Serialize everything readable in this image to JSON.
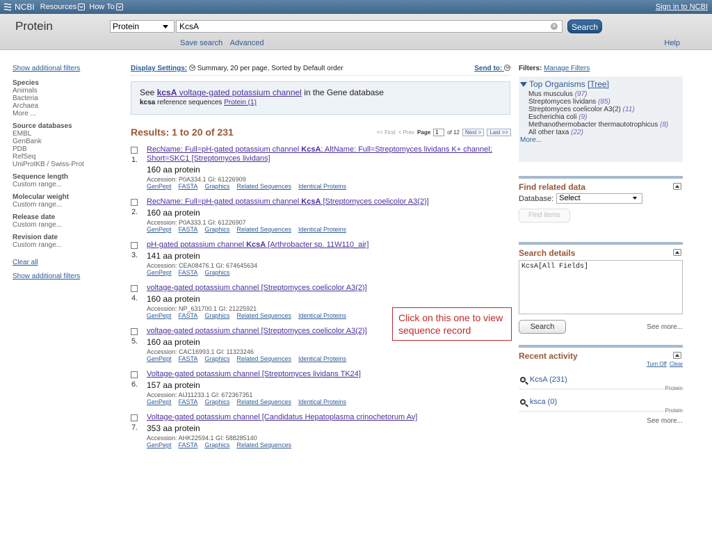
{
  "topbar": {
    "logo": "NCBI",
    "menus": [
      "Resources",
      "How To"
    ],
    "signin": "Sign in to NCBI"
  },
  "search": {
    "db_title": "Protein",
    "db_select": "Protein",
    "term": "KcsA",
    "button": "Search",
    "save_search": "Save search",
    "advanced": "Advanced",
    "help": "Help"
  },
  "left": {
    "show_filters_top": "Show additional filters",
    "sections": [
      {
        "title": "Species",
        "items": [
          "Animals",
          "Bacteria",
          "Archaea",
          "More ..."
        ]
      },
      {
        "title": "Source databases",
        "items": [
          "EMBL",
          "GenBank",
          "PDB",
          "RefSeq",
          "UniProtKB / Swiss-Prot"
        ]
      },
      {
        "title": "Sequence length",
        "items": [
          "Custom range..."
        ]
      },
      {
        "title": "Molecular weight",
        "items": [
          "Custom range..."
        ]
      },
      {
        "title": "Release date",
        "items": [
          "Custom range..."
        ]
      },
      {
        "title": "Revision date",
        "items": [
          "Custom range..."
        ]
      }
    ],
    "clear_all": "Clear all",
    "show_filters_bottom": "Show additional filters"
  },
  "display": {
    "settings_label": "Display Settings:",
    "settings_value": "Summary, 20 per page, Sorted by Default order",
    "send_to": "Send to:"
  },
  "gene_box": {
    "see": "See",
    "gene_link_bold": "kcsA",
    "gene_link_rest": "voltage-gated potassium channel",
    "in_db": "in the Gene database",
    "ref_bold": "kcsa",
    "ref_text": "reference sequences",
    "ref_link": "Protein (1)"
  },
  "results_header": {
    "title": "Results: 1 to 20 of 231",
    "first": "<< First",
    "prev": "< Prev",
    "page_label": "Page",
    "page": "1",
    "of": "of 12",
    "next": "Next >",
    "last": "Last >>"
  },
  "results": [
    {
      "num": "1.",
      "pre": "RecName: Full=pH-gated potassium channel ",
      "bold": "KcsA",
      "post": "; AltName: Full=Streptomyces lividans K+ channel; Short=SKC1 [Streptomyces lividans]",
      "desc": "160 aa protein",
      "acc": "Accession: P0A334.1   GI: 61226909",
      "links": [
        "GenPept",
        "FASTA",
        "Graphics",
        "Related Sequences",
        "Identical Proteins"
      ]
    },
    {
      "num": "2.",
      "pre": "RecName: Full=pH-gated potassium channel ",
      "bold": "KcsA",
      "post": " [Streptomyces coelicolor A3(2)]",
      "desc": "160 aa protein",
      "acc": "Accession: P0A333.1   GI: 61226907",
      "links": [
        "GenPept",
        "FASTA",
        "Graphics",
        "Related Sequences",
        "Identical Proteins"
      ]
    },
    {
      "num": "3.",
      "pre": "pH-gated potassium channel ",
      "bold": "KcsA",
      "post": " [Arthrobacter sp. 11W110_air]",
      "desc": "141 aa protein",
      "acc": "Accession: CEA08476.1   GI: 674645634",
      "links": [
        "GenPept",
        "FASTA",
        "Graphics"
      ]
    },
    {
      "num": "4.",
      "pre": "voltage-gated potassium channel [Streptomyces coelicolor A3(2)]",
      "bold": "",
      "post": "",
      "desc": "160 aa protein",
      "acc": "Accession: NP_631700.1   GI: 21225921",
      "links": [
        "GenPept",
        "FASTA",
        "Graphics",
        "Related Sequences",
        "Identical Proteins"
      ]
    },
    {
      "num": "5.",
      "pre": "voltage-gated potassium channel [Streptomyces coelicolor A3(2)]",
      "bold": "",
      "post": "",
      "desc": "160 aa protein",
      "acc": "Accession: CAC16993.1   GI: 11323246",
      "links": [
        "GenPept",
        "FASTA",
        "Graphics",
        "Related Sequences",
        "Identical Proteins"
      ]
    },
    {
      "num": "6.",
      "pre": "Voltage-gated potassium channel [Streptomyces lividans TK24]",
      "bold": "",
      "post": "",
      "desc": "157 aa protein",
      "acc": "Accession: AIJ11233.1   GI: 672367351",
      "links": [
        "GenPept",
        "FASTA",
        "Graphics",
        "Related Sequences",
        "Identical Proteins"
      ]
    },
    {
      "num": "7.",
      "pre": "Voltage-gated potassium channel [Candidatus Hepatoplasma crinochetorum Av]",
      "bold": "",
      "post": "",
      "desc": "353 aa protein",
      "acc": "Accession: AHK22594.1   GI: 588285140",
      "links": [
        "GenPept",
        "FASTA",
        "Graphics",
        "Related Sequences"
      ]
    }
  ],
  "callout": "Click on this one to view sequence record",
  "right": {
    "filters_label": "Filters:",
    "manage_filters": "Manage Filters",
    "top_organisms": "Top Organisms",
    "tree": "[Tree]",
    "organisms": [
      {
        "name": "Mus musculus",
        "count": "(97)"
      },
      {
        "name": "Streptomyces lividans",
        "count": "(85)"
      },
      {
        "name": "Streptomyces coelicolor A3(2)",
        "count": "(11)"
      },
      {
        "name": "Escherichia coli",
        "count": "(9)"
      },
      {
        "name": "Methanothermobacter thermautotrophicus",
        "count": "(8)"
      },
      {
        "name": "All other taxa",
        "count": "(22)"
      }
    ],
    "more": "More...",
    "find_related": "Find related data",
    "database_label": "Database:",
    "database_value": "Select",
    "find_items": "Find items",
    "search_details": "Search details",
    "query": "KcsA[All Fields]",
    "search_btn": "Search",
    "see_more": "See more...",
    "recent_activity": "Recent activity",
    "turn_off": "Turn Off",
    "clear": "Clear",
    "recent": [
      {
        "term": "KcsA (231)",
        "db": "Protein"
      },
      {
        "term": "ksca (0)",
        "db": "Protein"
      }
    ],
    "see_more2": "See more..."
  }
}
